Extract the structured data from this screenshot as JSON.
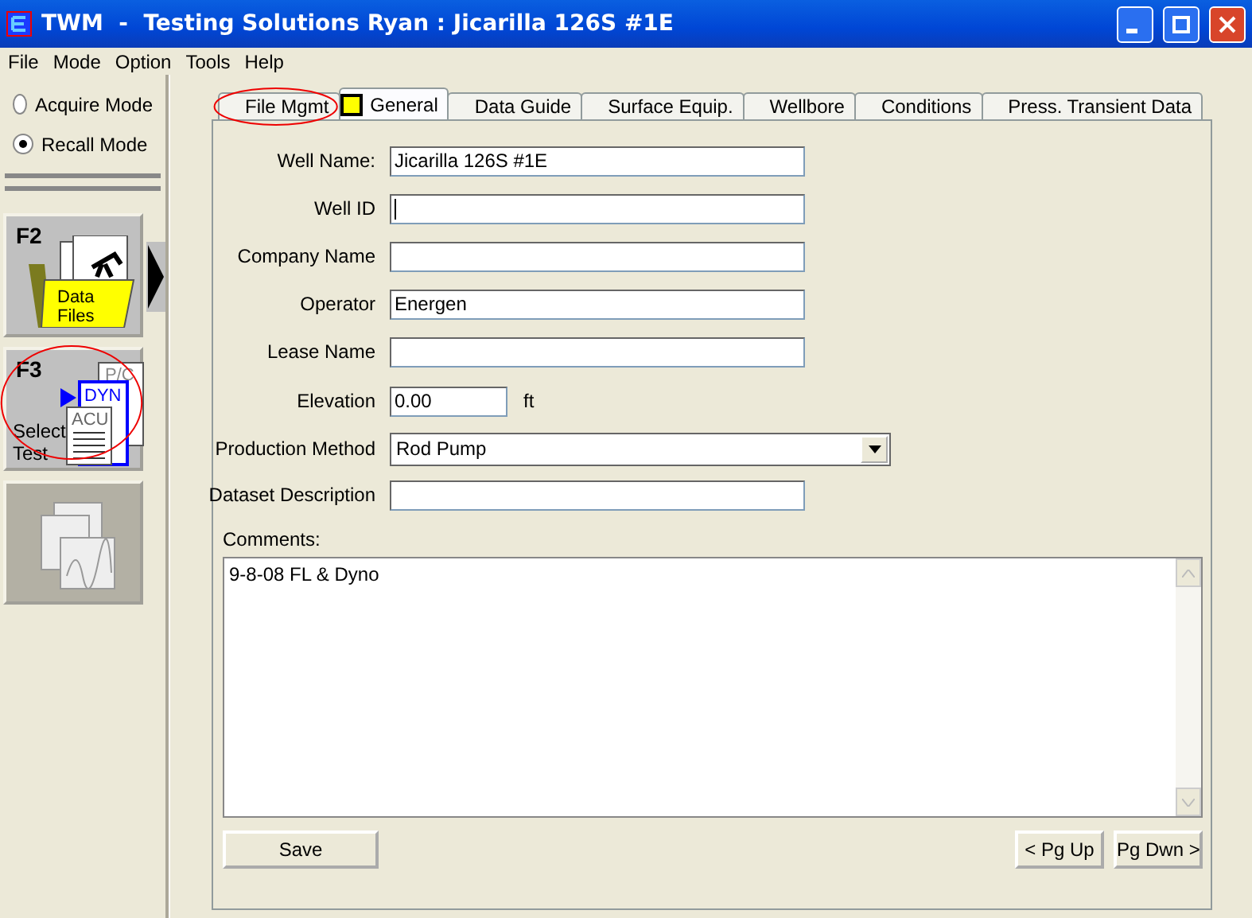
{
  "window": {
    "title": "TWM  -  Testing Solutions Ryan : Jicarilla 126S #1E"
  },
  "menu": [
    {
      "label": "File"
    },
    {
      "label": "Mode"
    },
    {
      "label": "Option"
    },
    {
      "label": "Tools"
    },
    {
      "label": "Help"
    }
  ],
  "modes": [
    {
      "label": "Acquire Mode",
      "selected": false
    },
    {
      "label": "Recall Mode",
      "selected": true
    }
  ],
  "side_buttons": [
    {
      "kind": "data_files",
      "key": "F2",
      "texts": [
        "Data",
        "Files"
      ],
      "disabled": false,
      "annotated": false
    },
    {
      "kind": "select_test",
      "key": "F3",
      "texts": [
        "Select",
        "Test",
        "P/C",
        "DYN",
        "ACU"
      ],
      "disabled": false,
      "annotated": true
    },
    {
      "kind": "charts",
      "disabled": true,
      "annotated": false
    }
  ],
  "tabs": [
    {
      "label": "File Mgmt",
      "selected": false,
      "annotated": true,
      "flag": false
    },
    {
      "label": "General",
      "selected": true,
      "annotated": false,
      "flag": true
    },
    {
      "label": "Data Guide",
      "selected": false,
      "annotated": false,
      "flag": false
    },
    {
      "label": "Surface Equip.",
      "selected": false,
      "annotated": false,
      "flag": false
    },
    {
      "label": "Wellbore",
      "selected": false,
      "annotated": false,
      "flag": false
    },
    {
      "label": "Conditions",
      "selected": false,
      "annotated": false,
      "flag": false
    },
    {
      "label": "Press. Transient Data",
      "selected": false,
      "annotated": false,
      "flag": false
    }
  ],
  "fields": [
    {
      "kind": "text",
      "label": "Well Name:",
      "value": "Jicarilla 126S #1E",
      "cursor": false
    },
    {
      "kind": "text",
      "label": "Well ID",
      "cursor": true
    },
    {
      "kind": "text",
      "label": "Company Name",
      "cursor": false
    },
    {
      "kind": "text",
      "label": "Operator",
      "value": "Energen",
      "cursor": false
    },
    {
      "kind": "text",
      "label": "Lease Name",
      "cursor": false
    },
    {
      "kind": "number",
      "label": "Elevation",
      "value": "0.00",
      "unit": "ft",
      "cursor": false
    },
    {
      "kind": "select",
      "label": "Production Method",
      "value": "Rod Pump"
    },
    {
      "kind": "text",
      "label": "Dataset Description",
      "cursor": false
    }
  ],
  "comments": {
    "label": "Comments:",
    "value": "9-8-08 FL & Dyno"
  },
  "buttons": {
    "save": {
      "label": "Save"
    },
    "pager": [
      "< Pg Up",
      "Pg Dwn >"
    ]
  }
}
